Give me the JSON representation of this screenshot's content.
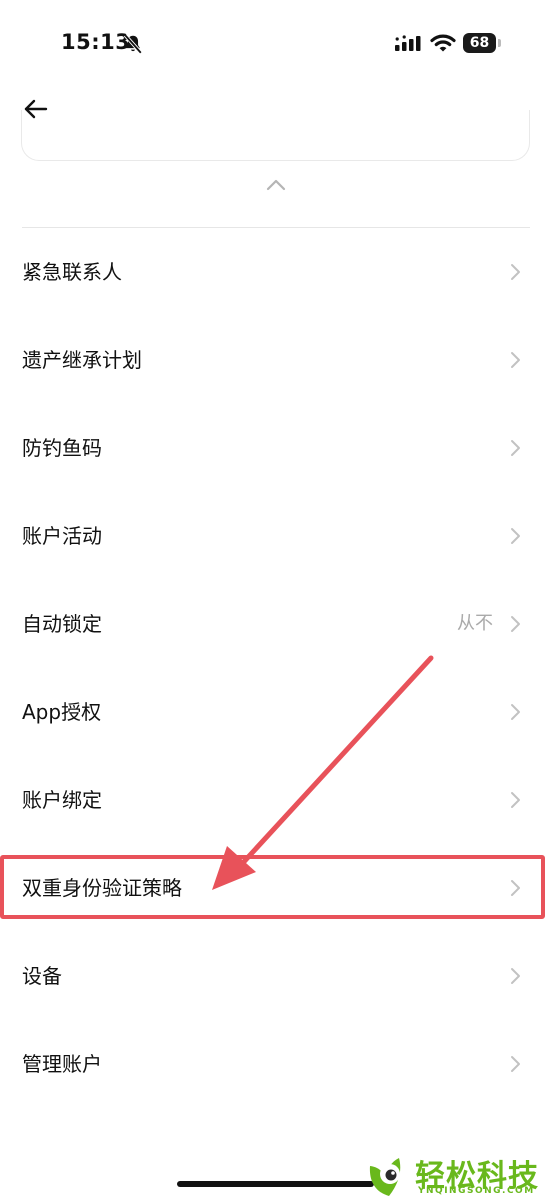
{
  "status_bar": {
    "time": "15:13",
    "battery": "68",
    "icons": [
      "bell-off-icon",
      "signal-icon",
      "wifi-icon",
      "battery-icon"
    ]
  },
  "nav": {
    "back_icon": "arrow-left-icon",
    "collapse_icon": "chevron-up-icon"
  },
  "menu": {
    "items": [
      {
        "label": "紧急联系人",
        "value": ""
      },
      {
        "label": "遗产继承计划",
        "value": ""
      },
      {
        "label": "防钓鱼码",
        "value": ""
      },
      {
        "label": "账户活动",
        "value": ""
      },
      {
        "label": "自动锁定",
        "value": "从不"
      },
      {
        "label": "App授权",
        "value": ""
      },
      {
        "label": "账户绑定",
        "value": ""
      },
      {
        "label": "双重身份验证策略",
        "value": ""
      },
      {
        "label": "设备",
        "value": ""
      },
      {
        "label": "管理账户",
        "value": ""
      }
    ],
    "chevron_icon": "chevron-right-icon"
  },
  "annotation": {
    "highlight_color": "#e8525a",
    "highlighted_item": "双重身份验证策略"
  },
  "watermark": {
    "brand": "轻松科技",
    "domain": "YNQINGSONG.COM",
    "color": "#69b81c"
  }
}
